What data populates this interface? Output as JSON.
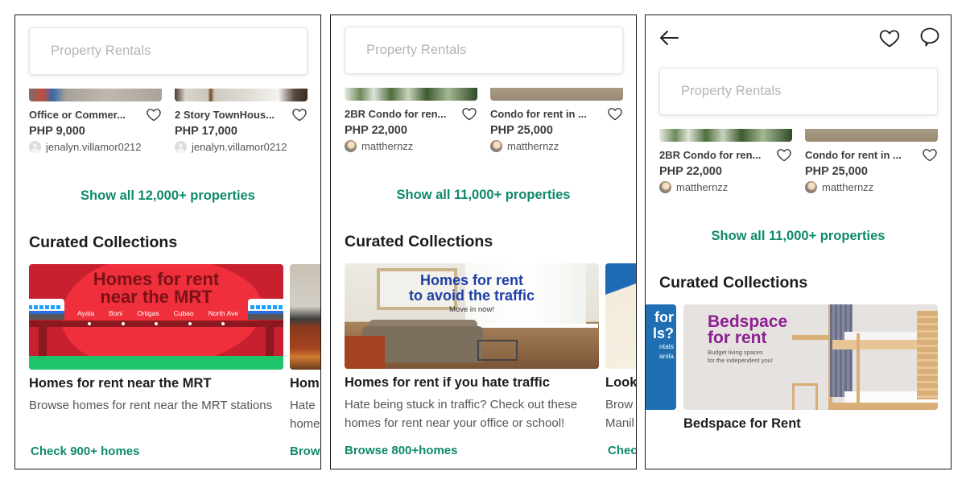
{
  "screens": [
    {
      "search": {
        "placeholder": "Property Rentals"
      },
      "listings": [
        {
          "title": "Office or Commer...",
          "price": "PHP 9,000",
          "seller": "jenalyn.villamor0212"
        },
        {
          "title": "2 Story TownHous...",
          "price": "PHP 17,000",
          "seller": "jenalyn.villamor0212"
        }
      ],
      "show_all": "Show all 12,000+ properties",
      "section_title": "Curated Collections",
      "collections": [
        {
          "banner": {
            "headline_1": "Homes for rent",
            "headline_2": "near the MRT",
            "stations": [
              "Ayala",
              "Boni",
              "Ortigas",
              "Cubao",
              "North Ave"
            ]
          },
          "title": "Homes for rent near the MRT",
          "description": "Browse homes for rent near the MRT stations",
          "link": "Check 900+ homes"
        },
        {
          "title": "Hom",
          "description": "Hate home",
          "link": "Brow"
        }
      ]
    },
    {
      "search": {
        "placeholder": "Property Rentals"
      },
      "listings": [
        {
          "title": "2BR Condo for ren...",
          "price": "PHP 22,000",
          "seller": "matthernzz"
        },
        {
          "title": "Condo for rent in ...",
          "price": "PHP 25,000",
          "seller": "matthernzz"
        }
      ],
      "show_all": "Show all 11,000+ properties",
      "section_title": "Curated Collections",
      "collections": [
        {
          "banner": {
            "headline_1": "Homes for rent",
            "headline_2": "to avoid the traffic",
            "sub": "Move in now!"
          },
          "title": "Homes for rent if you hate traffic",
          "description": "Hate being stuck in traffic? Check out these homes for rent near your office or school!",
          "link": "Browse 800+homes"
        },
        {
          "title": "Look",
          "description": "Brow Manil",
          "link": "Chec"
        }
      ]
    },
    {
      "header": {
        "back_icon": "arrow-left",
        "favorite_icon": "heart",
        "chat_icon": "speech-bubble"
      },
      "search": {
        "placeholder": "Property Rentals"
      },
      "listings": [
        {
          "title": "2BR Condo for ren...",
          "price": "PHP 22,000",
          "seller": "matthernzz"
        },
        {
          "title": "Condo for rent in ...",
          "price": "PHP 25,000",
          "seller": "matthernzz"
        }
      ],
      "show_all": "Show all 11,000+ properties",
      "section_title": "Curated Collections",
      "partial_banner": {
        "line_1": "for",
        "line_2": "ls?",
        "line_3": "ntals",
        "line_4": "anila"
      },
      "collections": [
        {
          "banner": {
            "headline_1": "Bedspace",
            "headline_2": "for rent",
            "sub_1": "Budget living spaces",
            "sub_2": "for the independent you!"
          },
          "title": "Bedspace for Rent"
        }
      ]
    }
  ],
  "colors": {
    "accent_green": "#0e8a6a",
    "text_dark": "#1c1c1c",
    "placeholder": "#b4b4b4",
    "mrt_red": "#c8202e",
    "traffic_blue": "#1e3fa8",
    "bedspace_purple": "#8d1f93"
  }
}
